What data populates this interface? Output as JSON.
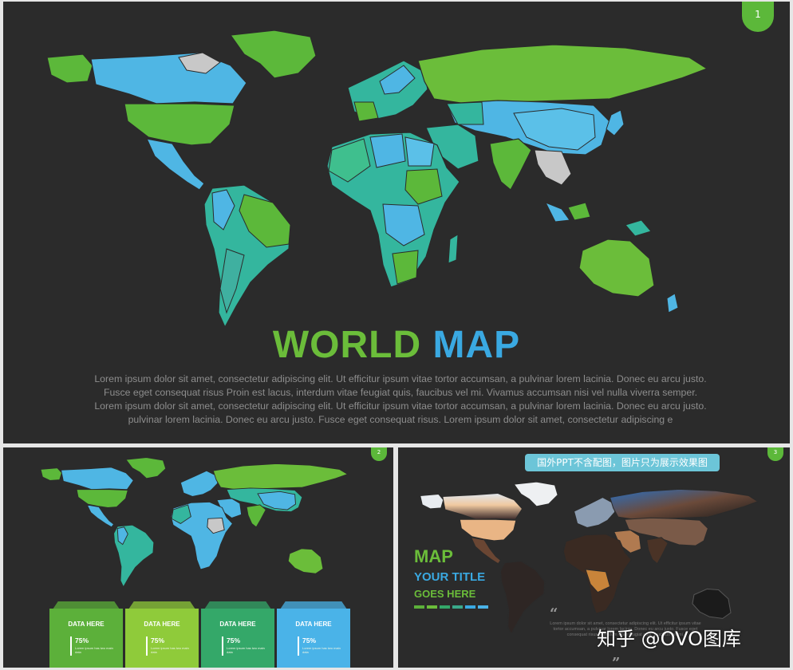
{
  "slide1": {
    "number": "1",
    "title_word1": "WORLD",
    "title_word2": "MAP",
    "paragraph_lines": [
      "Lorem ipsum dolor sit amet, consectetur adipiscing elit. Ut efficitur ipsum vitae tortor accumsan, a pulvinar lorem lacinia. Donec eu arcu justo.",
      "Fusce eget consequat risus Proin est lacus, interdum vitae feugiat quis, faucibus vel mi.  Vivamus accumsan nisi vel nulla viverra semper.",
      "Lorem ipsum dolor sit amet, consectetur adipiscing elit. Ut efficitur ipsum vitae tortor accumsan, a pulvinar lorem lacinia. Donec eu arcu justo.",
      "pulvinar lorem lacinia. Donec eu arcu justo. Fusce eget consequat risus. Lorem ipsum dolor sit amet, consectetur  adipiscing e"
    ]
  },
  "slide2": {
    "number": "2",
    "cards": [
      {
        "label": "DATA HERE",
        "percent": "75%",
        "text": "Lorem ipsum has two main data",
        "color": "#5cb03a"
      },
      {
        "label": "DATA HERE",
        "percent": "75%",
        "text": "Lorem ipsum has two main data",
        "color": "#8fcb3a"
      },
      {
        "label": "DATA HERE",
        "percent": "75%",
        "text": "Lorem ipsum has two main data",
        "color": "#34a869"
      },
      {
        "label": "DATA HERE",
        "percent": "75%",
        "text": "Lorem ipsum has two main data",
        "color": "#4ab3e8"
      }
    ]
  },
  "slide3": {
    "number": "3",
    "banner": "国外PPT不含配图，图片只为展示效果图",
    "map_label": "MAP",
    "your_title": "YOUR TITLE",
    "goes_here": "GOES HERE",
    "quote_open": "“",
    "quote_close": "”",
    "paragraph": "Lorem ipsum dolor sit amet, consectetur adipiscing elit. Ut efficitur ipsum vitae tortor accumsan, a pulvinar lorem lacinia. Donec eu arcu justo. Fusce eget consequat risus, interdum vitae feugiat quis, faucibus vel mi.",
    "swatch_colors": [
      "#5cb03a",
      "#6bbd3a",
      "#34a869",
      "#3aa98a",
      "#3aa9e2",
      "#4ab3e8"
    ]
  },
  "watermark": "知乎 @OVO图库",
  "colors": {
    "green": "#6bbd3a",
    "blue": "#3aa9e2",
    "teal": "#34b69e",
    "grey_land": "#c8c8c8",
    "background": "#2b2b2b"
  }
}
